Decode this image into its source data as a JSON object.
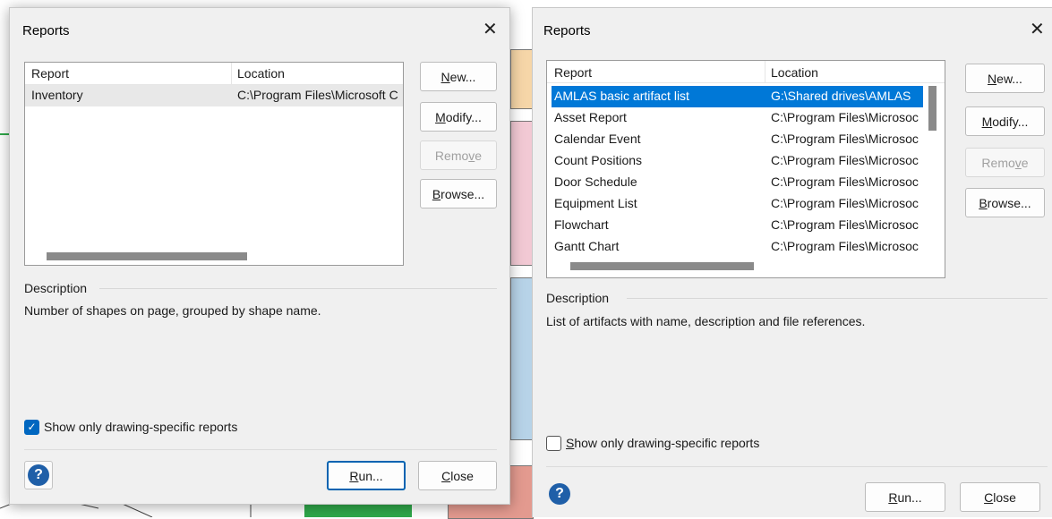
{
  "left_dialog": {
    "title": "Reports",
    "close_glyph": "✕",
    "columns": [
      "Report",
      "Location"
    ],
    "rows": [
      {
        "report": "Inventory",
        "location": "C:\\Program Files\\Microsoft C"
      }
    ],
    "buttons": {
      "new": {
        "pre": "",
        "mn": "N",
        "post": "ew..."
      },
      "modify": {
        "pre": "",
        "mn": "M",
        "post": "odify..."
      },
      "remove": {
        "pre": "Remo",
        "mn": "v",
        "post": "e"
      },
      "browse": {
        "pre": "",
        "mn": "B",
        "post": "rowse..."
      },
      "run": {
        "pre": "",
        "mn": "R",
        "post": "un..."
      },
      "close": {
        "pre": "",
        "mn": "C",
        "post": "lose"
      }
    },
    "description_label": "Description",
    "description_text": "Number of shapes on page, grouped by shape name.",
    "checkbox_label": "Show only drawing-specific reports",
    "checkbox_checked": true,
    "help_glyph": "?"
  },
  "right_dialog": {
    "title": "Reports",
    "close_glyph": "✕",
    "columns": [
      "Report",
      "Location"
    ],
    "rows": [
      {
        "report": "AMLAS basic artifact list",
        "location": "G:\\Shared drives\\AMLAS",
        "selected": true
      },
      {
        "report": "Asset Report",
        "location": "C:\\Program Files\\Microsoc"
      },
      {
        "report": "Calendar Event",
        "location": "C:\\Program Files\\Microsoc"
      },
      {
        "report": "Count Positions",
        "location": "C:\\Program Files\\Microsoc"
      },
      {
        "report": "Door Schedule",
        "location": "C:\\Program Files\\Microsoc"
      },
      {
        "report": "Equipment List",
        "location": "C:\\Program Files\\Microsoc"
      },
      {
        "report": "Flowchart",
        "location": "C:\\Program Files\\Microsoc"
      },
      {
        "report": "Gantt Chart",
        "location": "C:\\Program Files\\Microsoc"
      }
    ],
    "buttons": {
      "new": {
        "pre": "",
        "mn": "N",
        "post": "ew..."
      },
      "modify": {
        "pre": "",
        "mn": "M",
        "post": "odify..."
      },
      "remove": {
        "pre": "Remo",
        "mn": "v",
        "post": "e"
      },
      "browse": {
        "pre": "",
        "mn": "B",
        "post": "rowse..."
      },
      "run": {
        "pre": "",
        "mn": "R",
        "post": "un..."
      },
      "close": {
        "pre": "",
        "mn": "C",
        "post": "lose"
      }
    },
    "description_label": "Description",
    "description_text": "List of artifacts with name, description and file references.",
    "checkbox_label_pre": "",
    "checkbox_label_mn": "S",
    "checkbox_label_post": "how only drawing-specific reports",
    "checkbox_checked": false,
    "help_glyph": "?"
  },
  "background": {
    "colors": {
      "peach": "#f6d6a8",
      "pink": "#f2c9d4",
      "blue": "#b7d3e8",
      "salmon": "#e39a8f",
      "green": "#2fa84a"
    }
  }
}
